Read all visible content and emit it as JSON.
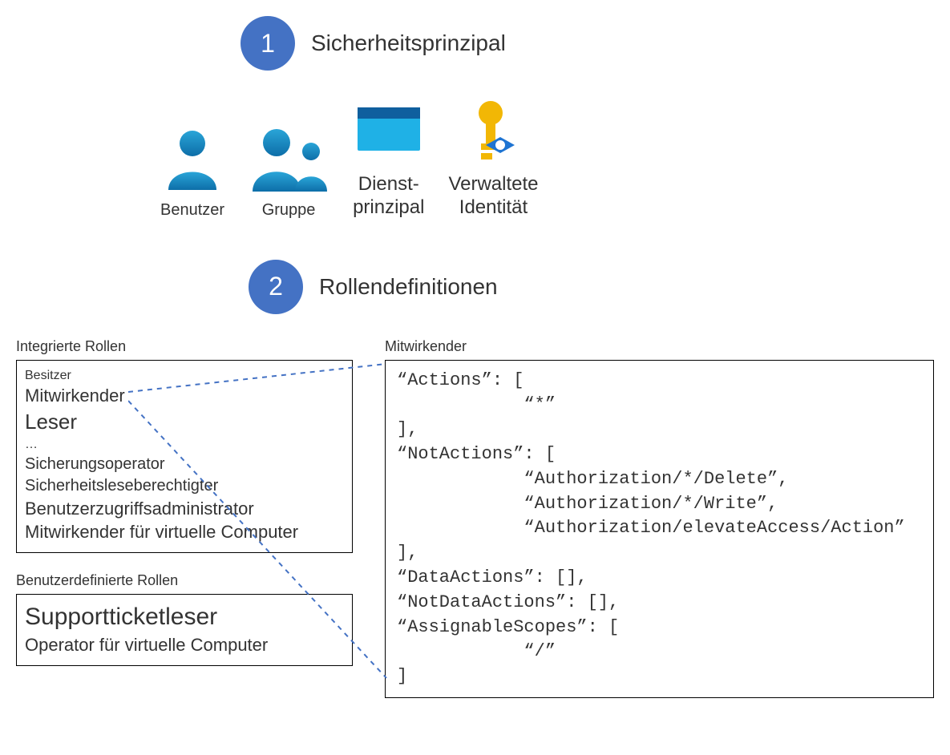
{
  "step1": {
    "num": "1",
    "title": "Sicherheitsprinzipal"
  },
  "principals": {
    "user": {
      "label": "Benutzer"
    },
    "group": {
      "label": "Gruppe"
    },
    "sp": {
      "label": "Dienst-\nprinzipal"
    },
    "mi": {
      "label": "Verwaltete\nIdentität"
    }
  },
  "step2": {
    "num": "2",
    "title": "Rollendefinitionen"
  },
  "builtin": {
    "label": "Integrierte Rollen",
    "items": {
      "owner": "Besitzer",
      "contributor": "Mitwirkender",
      "reader": "Leser",
      "ellipsis": "…",
      "backup": "Sicherungsoperator",
      "secreader": "Sicherheitsleseberechtigter",
      "uaa": "Benutzerzugriffsadministrator",
      "vmcontrib": "Mitwirkender für virtuelle Computer"
    }
  },
  "custom": {
    "label": "Benutzerdefinierte Rollen",
    "items": {
      "ticket": "Supportticketleser",
      "vmop": "Operator für virtuelle Computer"
    }
  },
  "definition": {
    "label": "Mitwirkender",
    "code": "“Actions”: [\n            “*”\n],\n“NotActions”: [\n            “Authorization/*/Delete”,\n            “Authorization/*/Write”,\n            “Authorization/elevateAccess/Action”\n],\n“DataActions”: [],\n“NotDataActions”: [],\n“AssignableScopes”: [\n            “/”\n]"
  }
}
